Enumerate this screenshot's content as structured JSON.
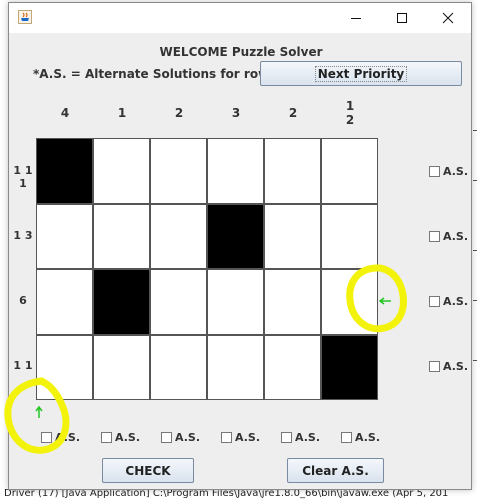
{
  "window": {
    "title_icon": "java-icon"
  },
  "header": {
    "welcome": "WELCOME Puzzle Solver",
    "note": "*A.S. = Alternate Solutions for row/col",
    "next_priority_label": "Next Priority"
  },
  "column_clues": [
    {
      "lines": [
        "4"
      ]
    },
    {
      "lines": [
        "1"
      ]
    },
    {
      "lines": [
        "2"
      ]
    },
    {
      "lines": [
        "3"
      ]
    },
    {
      "lines": [
        "2"
      ]
    },
    {
      "lines": [
        "1",
        "2"
      ]
    }
  ],
  "row_clues": [
    "1 1 1",
    "1 3",
    "6",
    "1 1"
  ],
  "grid": [
    [
      1,
      0,
      0,
      0,
      0,
      0
    ],
    [
      0,
      0,
      0,
      1,
      0,
      0
    ],
    [
      0,
      1,
      0,
      0,
      0,
      0
    ],
    [
      0,
      0,
      0,
      0,
      0,
      1
    ]
  ],
  "as_label": "A.S.",
  "row_as_count": 4,
  "col_as_count": 6,
  "buttons": {
    "check": "CHECK",
    "clear": "Clear A.S."
  },
  "background": {
    "console_text": "Driver (17) [Java Application] C:\\Program Files\\Java\\jre1.8.0_66\\bin\\javaw.exe (Apr 5, 201"
  },
  "colors": {
    "highlight": "#f2f20a",
    "arrow": "#22c522",
    "filled": "#000000",
    "window_bg": "#eeeeee"
  }
}
